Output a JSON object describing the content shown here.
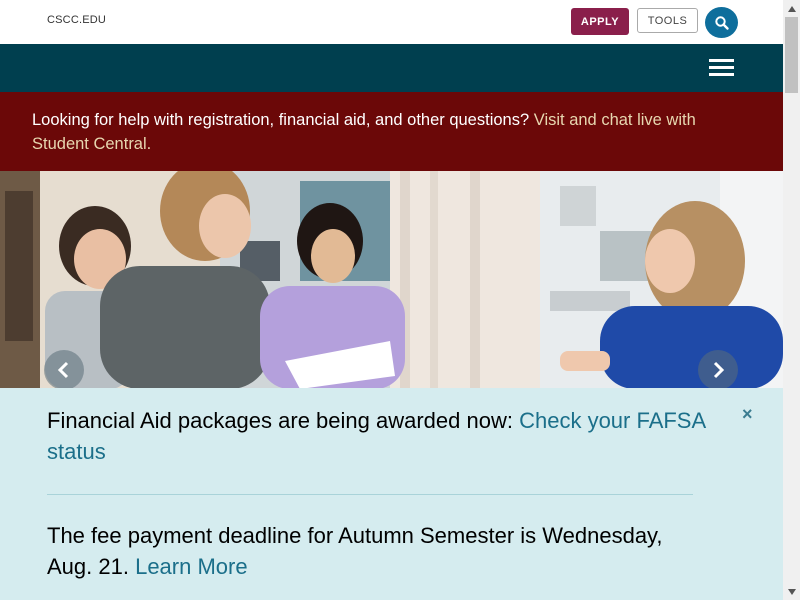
{
  "header": {
    "site_link": "CSCC.EDU",
    "apply_label": "APPLY",
    "tools_label": "TOOLS"
  },
  "alert": {
    "text": "Looking for help with registration, financial aid, and other questions?",
    "link": "Visit and chat live with Student Central."
  },
  "notices": [
    {
      "text": "Financial Aid packages are being awarded now:",
      "link": "Check your FAFSA status"
    },
    {
      "text": "The fee payment deadline for Autumn Semester is Wednesday, Aug. 21.",
      "link": "Learn More"
    }
  ],
  "close_label": "×",
  "colors": {
    "apply": "#8a1f4b",
    "search": "#0e6e9c",
    "nav": "#003f4f",
    "alert_bg": "#6b0808",
    "alert_link": "#e7d7b0",
    "notice_bg": "#d5ecef",
    "notice_link": "#1b6f8a"
  },
  "icons": {
    "search": "search-icon",
    "menu": "hamburger-icon",
    "prev": "chevron-left-icon",
    "next": "chevron-right-icon",
    "close": "close-icon"
  }
}
